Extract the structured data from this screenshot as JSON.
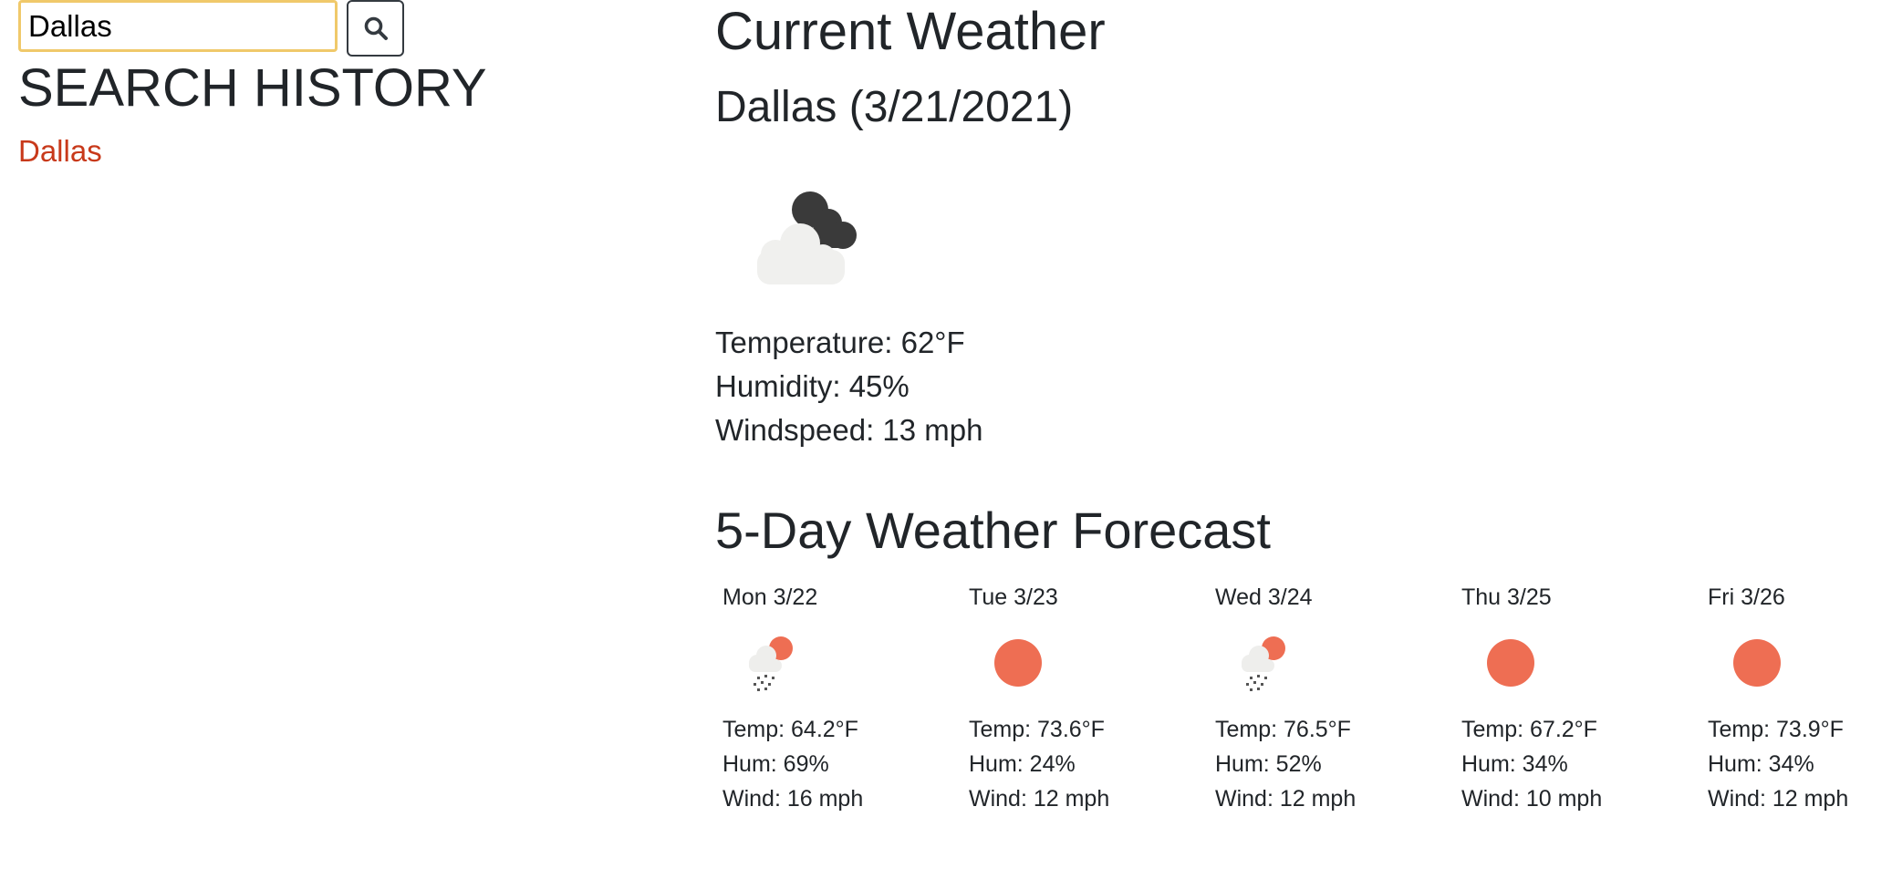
{
  "search": {
    "value": "Dallas",
    "button_icon": "search-icon"
  },
  "history": {
    "title": "SEARCH HISTORY",
    "items": [
      "Dallas"
    ],
    "link_color": "#c8391a"
  },
  "current": {
    "title": "Current Weather",
    "city_date": "Dallas (3/21/2021)",
    "icon": "cloudy-night-icon",
    "temperature": "Temperature: 62°F",
    "humidity": "Humidity: 45%",
    "windspeed": "Windspeed: 13 mph"
  },
  "forecast": {
    "title": "5-Day Weather Forecast",
    "days": [
      {
        "day": "Mon 3/22",
        "icon": "rain-sun-icon",
        "temp": "Temp: 64.2°F",
        "hum": "Hum: 69%",
        "wind": "Wind: 16 mph"
      },
      {
        "day": "Tue 3/23",
        "icon": "sun-icon",
        "temp": "Temp: 73.6°F",
        "hum": "Hum: 24%",
        "wind": "Wind: 12 mph"
      },
      {
        "day": "Wed 3/24",
        "icon": "rain-sun-icon",
        "temp": "Temp: 76.5°F",
        "hum": "Hum: 52%",
        "wind": "Wind: 12 mph"
      },
      {
        "day": "Thu 3/25",
        "icon": "sun-icon",
        "temp": "Temp: 67.2°F",
        "hum": "Hum: 34%",
        "wind": "Wind: 10 mph"
      },
      {
        "day": "Fri 3/26",
        "icon": "sun-icon",
        "temp": "Temp: 73.9°F",
        "hum": "Hum: 34%",
        "wind": "Wind: 12 mph"
      }
    ]
  },
  "colors": {
    "accent": "#f0c96a",
    "sun": "#ee6e53",
    "cloud": "#f0f0ee",
    "dark_cloud": "#3a3a3a"
  }
}
